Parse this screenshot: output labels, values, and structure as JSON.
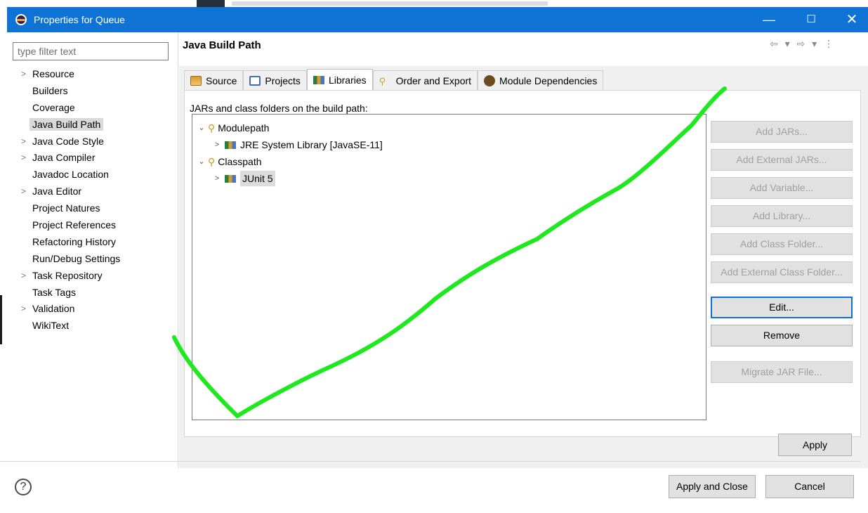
{
  "window": {
    "title": "Properties for Queue",
    "controls": {
      "minimize": "—",
      "maximize": "☐",
      "close": "✕"
    }
  },
  "filter": {
    "placeholder": "type filter text",
    "value": ""
  },
  "nav": {
    "items": [
      {
        "label": "Resource",
        "expandable": true
      },
      {
        "label": "Builders",
        "expandable": false
      },
      {
        "label": "Coverage",
        "expandable": false
      },
      {
        "label": "Java Build Path",
        "expandable": false,
        "selected": true
      },
      {
        "label": "Java Code Style",
        "expandable": true
      },
      {
        "label": "Java Compiler",
        "expandable": true
      },
      {
        "label": "Javadoc Location",
        "expandable": false
      },
      {
        "label": "Java Editor",
        "expandable": true
      },
      {
        "label": "Project Natures",
        "expandable": false
      },
      {
        "label": "Project References",
        "expandable": false
      },
      {
        "label": "Refactoring History",
        "expandable": false
      },
      {
        "label": "Run/Debug Settings",
        "expandable": false
      },
      {
        "label": "Task Repository",
        "expandable": true
      },
      {
        "label": "Task Tags",
        "expandable": false
      },
      {
        "label": "Validation",
        "expandable": true
      },
      {
        "label": "WikiText",
        "expandable": false
      }
    ]
  },
  "page": {
    "title": "Java Build Path",
    "nav_arrows": "⇦ ▾ ⇨ ▾ ⋮"
  },
  "tabs": [
    {
      "label": "Source",
      "icon": "source-folder-icon"
    },
    {
      "label": "Projects",
      "icon": "projects-icon"
    },
    {
      "label": "Libraries",
      "icon": "libraries-icon",
      "active": true
    },
    {
      "label": "Order and Export",
      "icon": "order-export-icon"
    },
    {
      "label": "Module Dependencies",
      "icon": "module-dependencies-icon"
    }
  ],
  "libraries": {
    "heading": "JARs and class folders on the build path:",
    "tree": [
      {
        "label": "Modulepath",
        "level": 0,
        "expanded": true,
        "icon": "classpath-container-icon"
      },
      {
        "label": "JRE System Library [JavaSE-11]",
        "level": 1,
        "expanded": false,
        "icon": "library-icon"
      },
      {
        "label": "Classpath",
        "level": 0,
        "expanded": true,
        "icon": "classpath-container-icon"
      },
      {
        "label": "JUnit 5",
        "level": 1,
        "expanded": false,
        "icon": "library-icon",
        "selected": true
      }
    ]
  },
  "side_buttons": {
    "add_jars": "Add JARs...",
    "add_external_jars": "Add External JARs...",
    "add_variable": "Add Variable...",
    "add_library": "Add Library...",
    "add_class_folder": "Add Class Folder...",
    "add_external_class_folder": "Add External Class Folder...",
    "edit": "Edit...",
    "remove": "Remove",
    "migrate_jar": "Migrate JAR File..."
  },
  "buttons": {
    "apply": "Apply",
    "apply_and_close": "Apply and Close",
    "cancel": "Cancel",
    "help": "?"
  },
  "colors": {
    "titlebar": "#0f73d6",
    "annotation": "#1ee81e"
  }
}
